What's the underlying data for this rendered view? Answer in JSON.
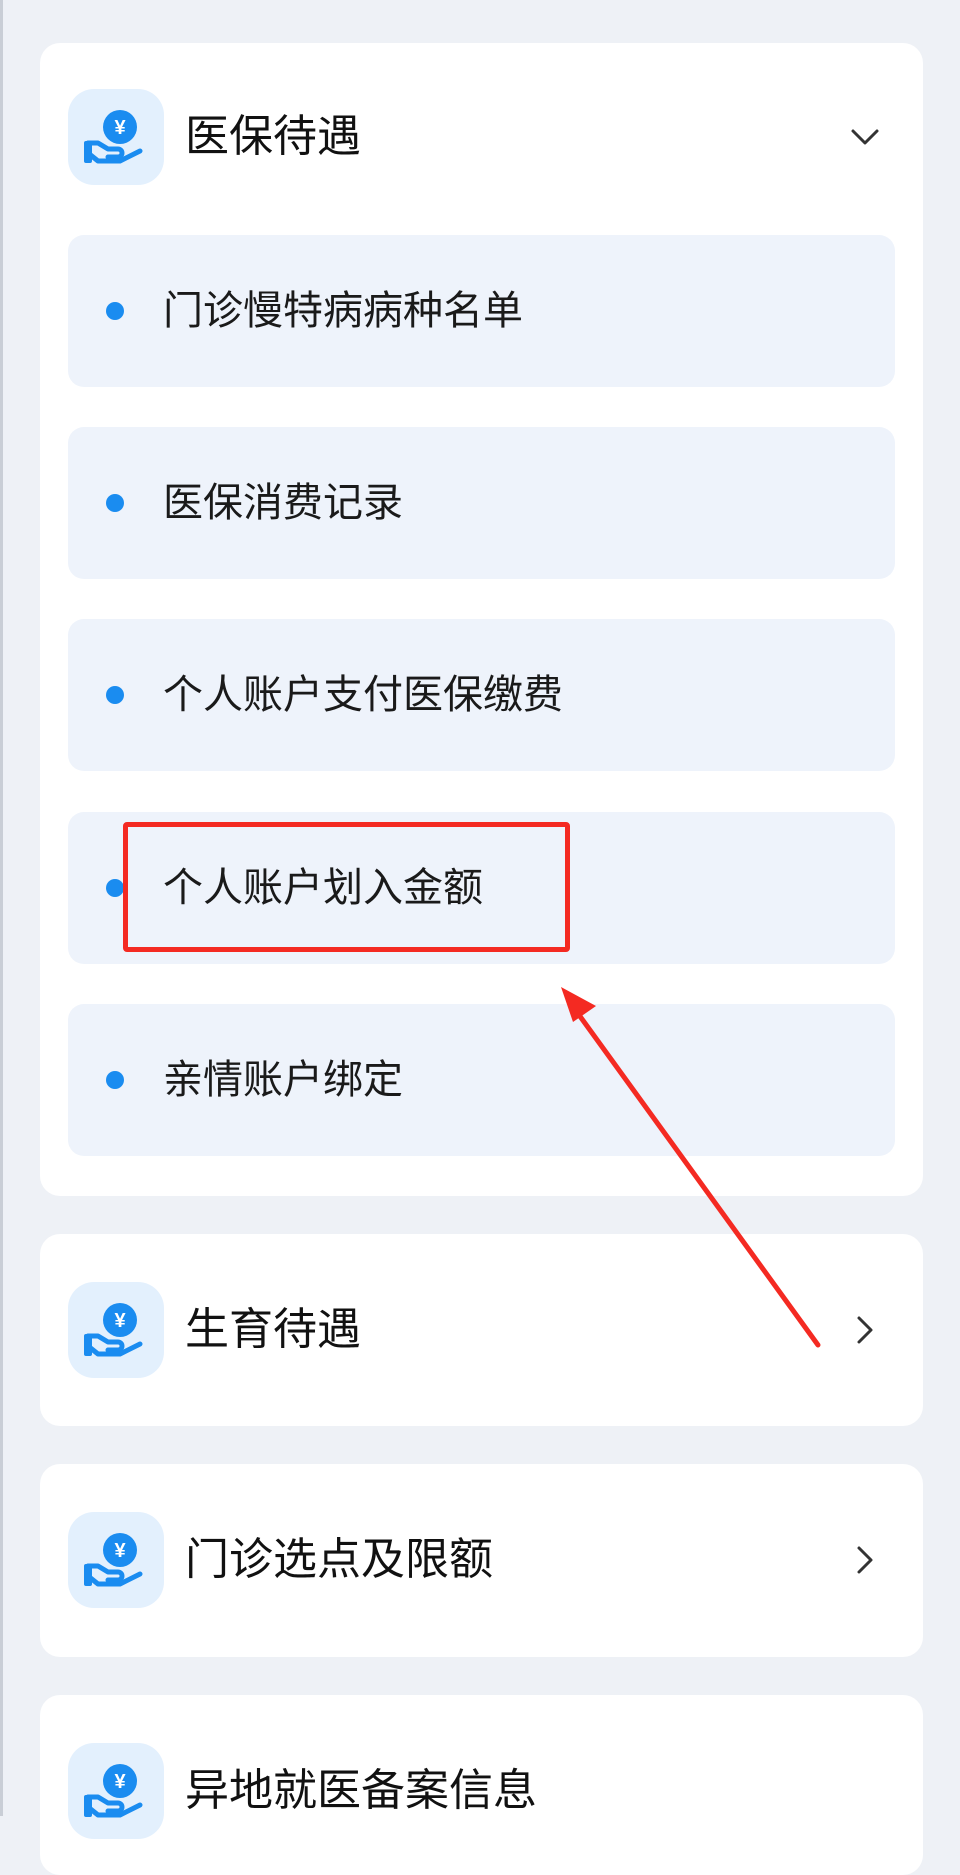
{
  "colors": {
    "page_bg": "#eef1f6",
    "card_bg": "#ffffff",
    "item_bg": "#eef3fb",
    "icon_tile_bg": "#e3f0fd",
    "accent_blue": "#1a8cf0",
    "annotation_red": "#f42a22"
  },
  "sections": [
    {
      "title": "医保待遇",
      "icon": "hand-coin-icon",
      "state": "expanded",
      "toggle_icon": "chevron-down-icon",
      "items": [
        {
          "label": "门诊慢特病病种名单"
        },
        {
          "label": "医保消费记录"
        },
        {
          "label": "个人账户支付医保缴费"
        },
        {
          "label": "个人账户划入金额",
          "highlighted": true
        },
        {
          "label": "亲情账户绑定"
        }
      ]
    },
    {
      "title": "生育待遇",
      "icon": "hand-coin-icon",
      "state": "collapsed",
      "toggle_icon": "chevron-right-icon"
    },
    {
      "title": "门诊选点及限额",
      "icon": "hand-coin-icon",
      "state": "collapsed",
      "toggle_icon": "chevron-right-icon"
    },
    {
      "title": "异地就医备案信息",
      "icon": "hand-coin-icon",
      "state": "collapsed"
    }
  ],
  "annotation": {
    "type": "red box with arrow",
    "target": "个人账户划入金额"
  }
}
